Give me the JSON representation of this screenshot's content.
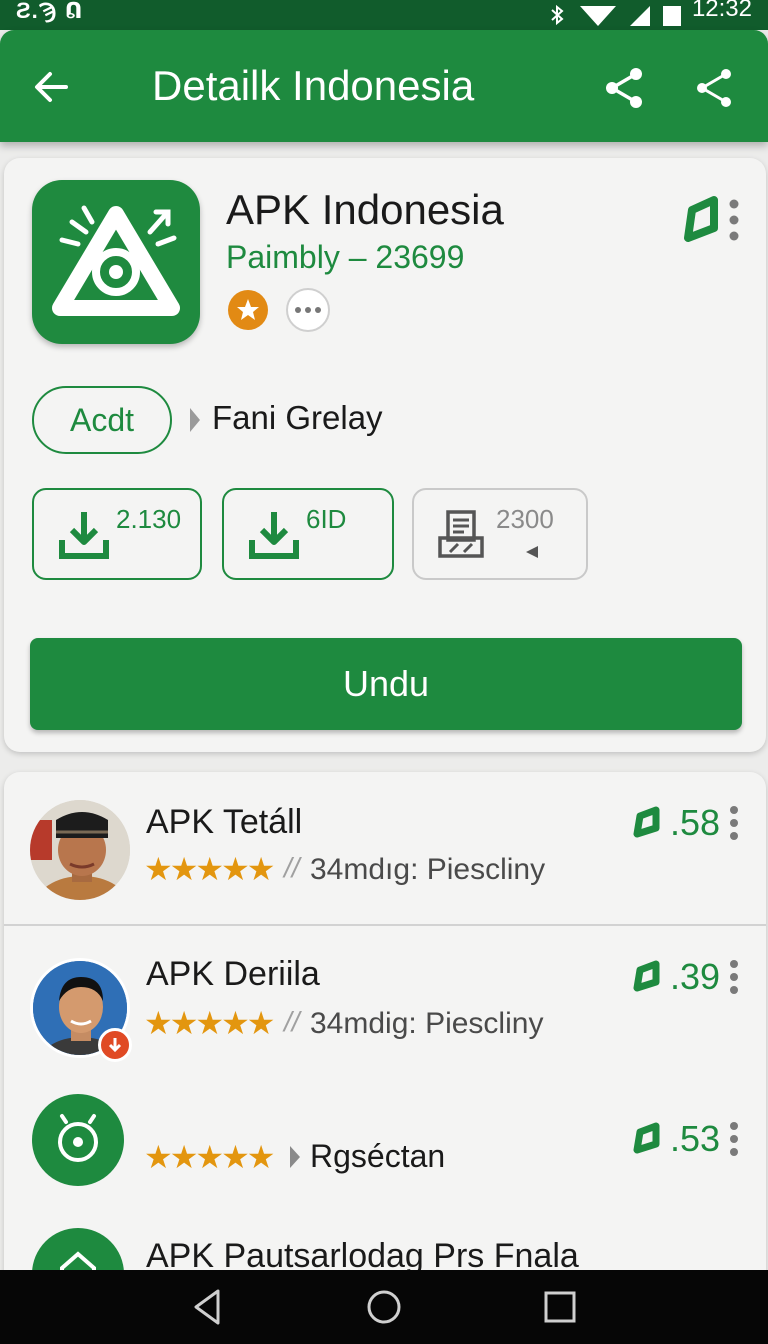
{
  "status_bar": {
    "left_text": "Ƨ.Ϡ ᕠ",
    "time": "12:32"
  },
  "app_bar": {
    "title": "Detailk Indonesia"
  },
  "app": {
    "name": "APK Indonesia",
    "subtitle": "Paimbly – 23699",
    "category_pill": "Acdt",
    "breadcrumb": "Fani Grelay",
    "stats": [
      {
        "icon": "download-icon",
        "value": "2.130"
      },
      {
        "icon": "download-icon",
        "value": "6ID"
      },
      {
        "icon": "file-icon",
        "value": "2300"
      }
    ],
    "download_button": "Undu"
  },
  "list": [
    {
      "title": "APK Tetáll",
      "stars": "★★★★★",
      "separator": "//",
      "meta": "34mdıg: Piescliny",
      "score": ".58"
    },
    {
      "title": "APK Deriila",
      "stars": "★★★★★",
      "separator": "//",
      "meta": "34mdig: Piescliny",
      "score": ".39"
    },
    {
      "title": "",
      "stars": "★★★★★",
      "meta": "Rgséctan",
      "score": ".53"
    },
    {
      "title": "APK  Pautsarlodag Prs Fnala"
    }
  ],
  "colors": {
    "primary_green": "#1e8a3f",
    "dark_green": "#115c2c",
    "star_orange": "#e3960f",
    "badge_orange": "#e28a14"
  }
}
